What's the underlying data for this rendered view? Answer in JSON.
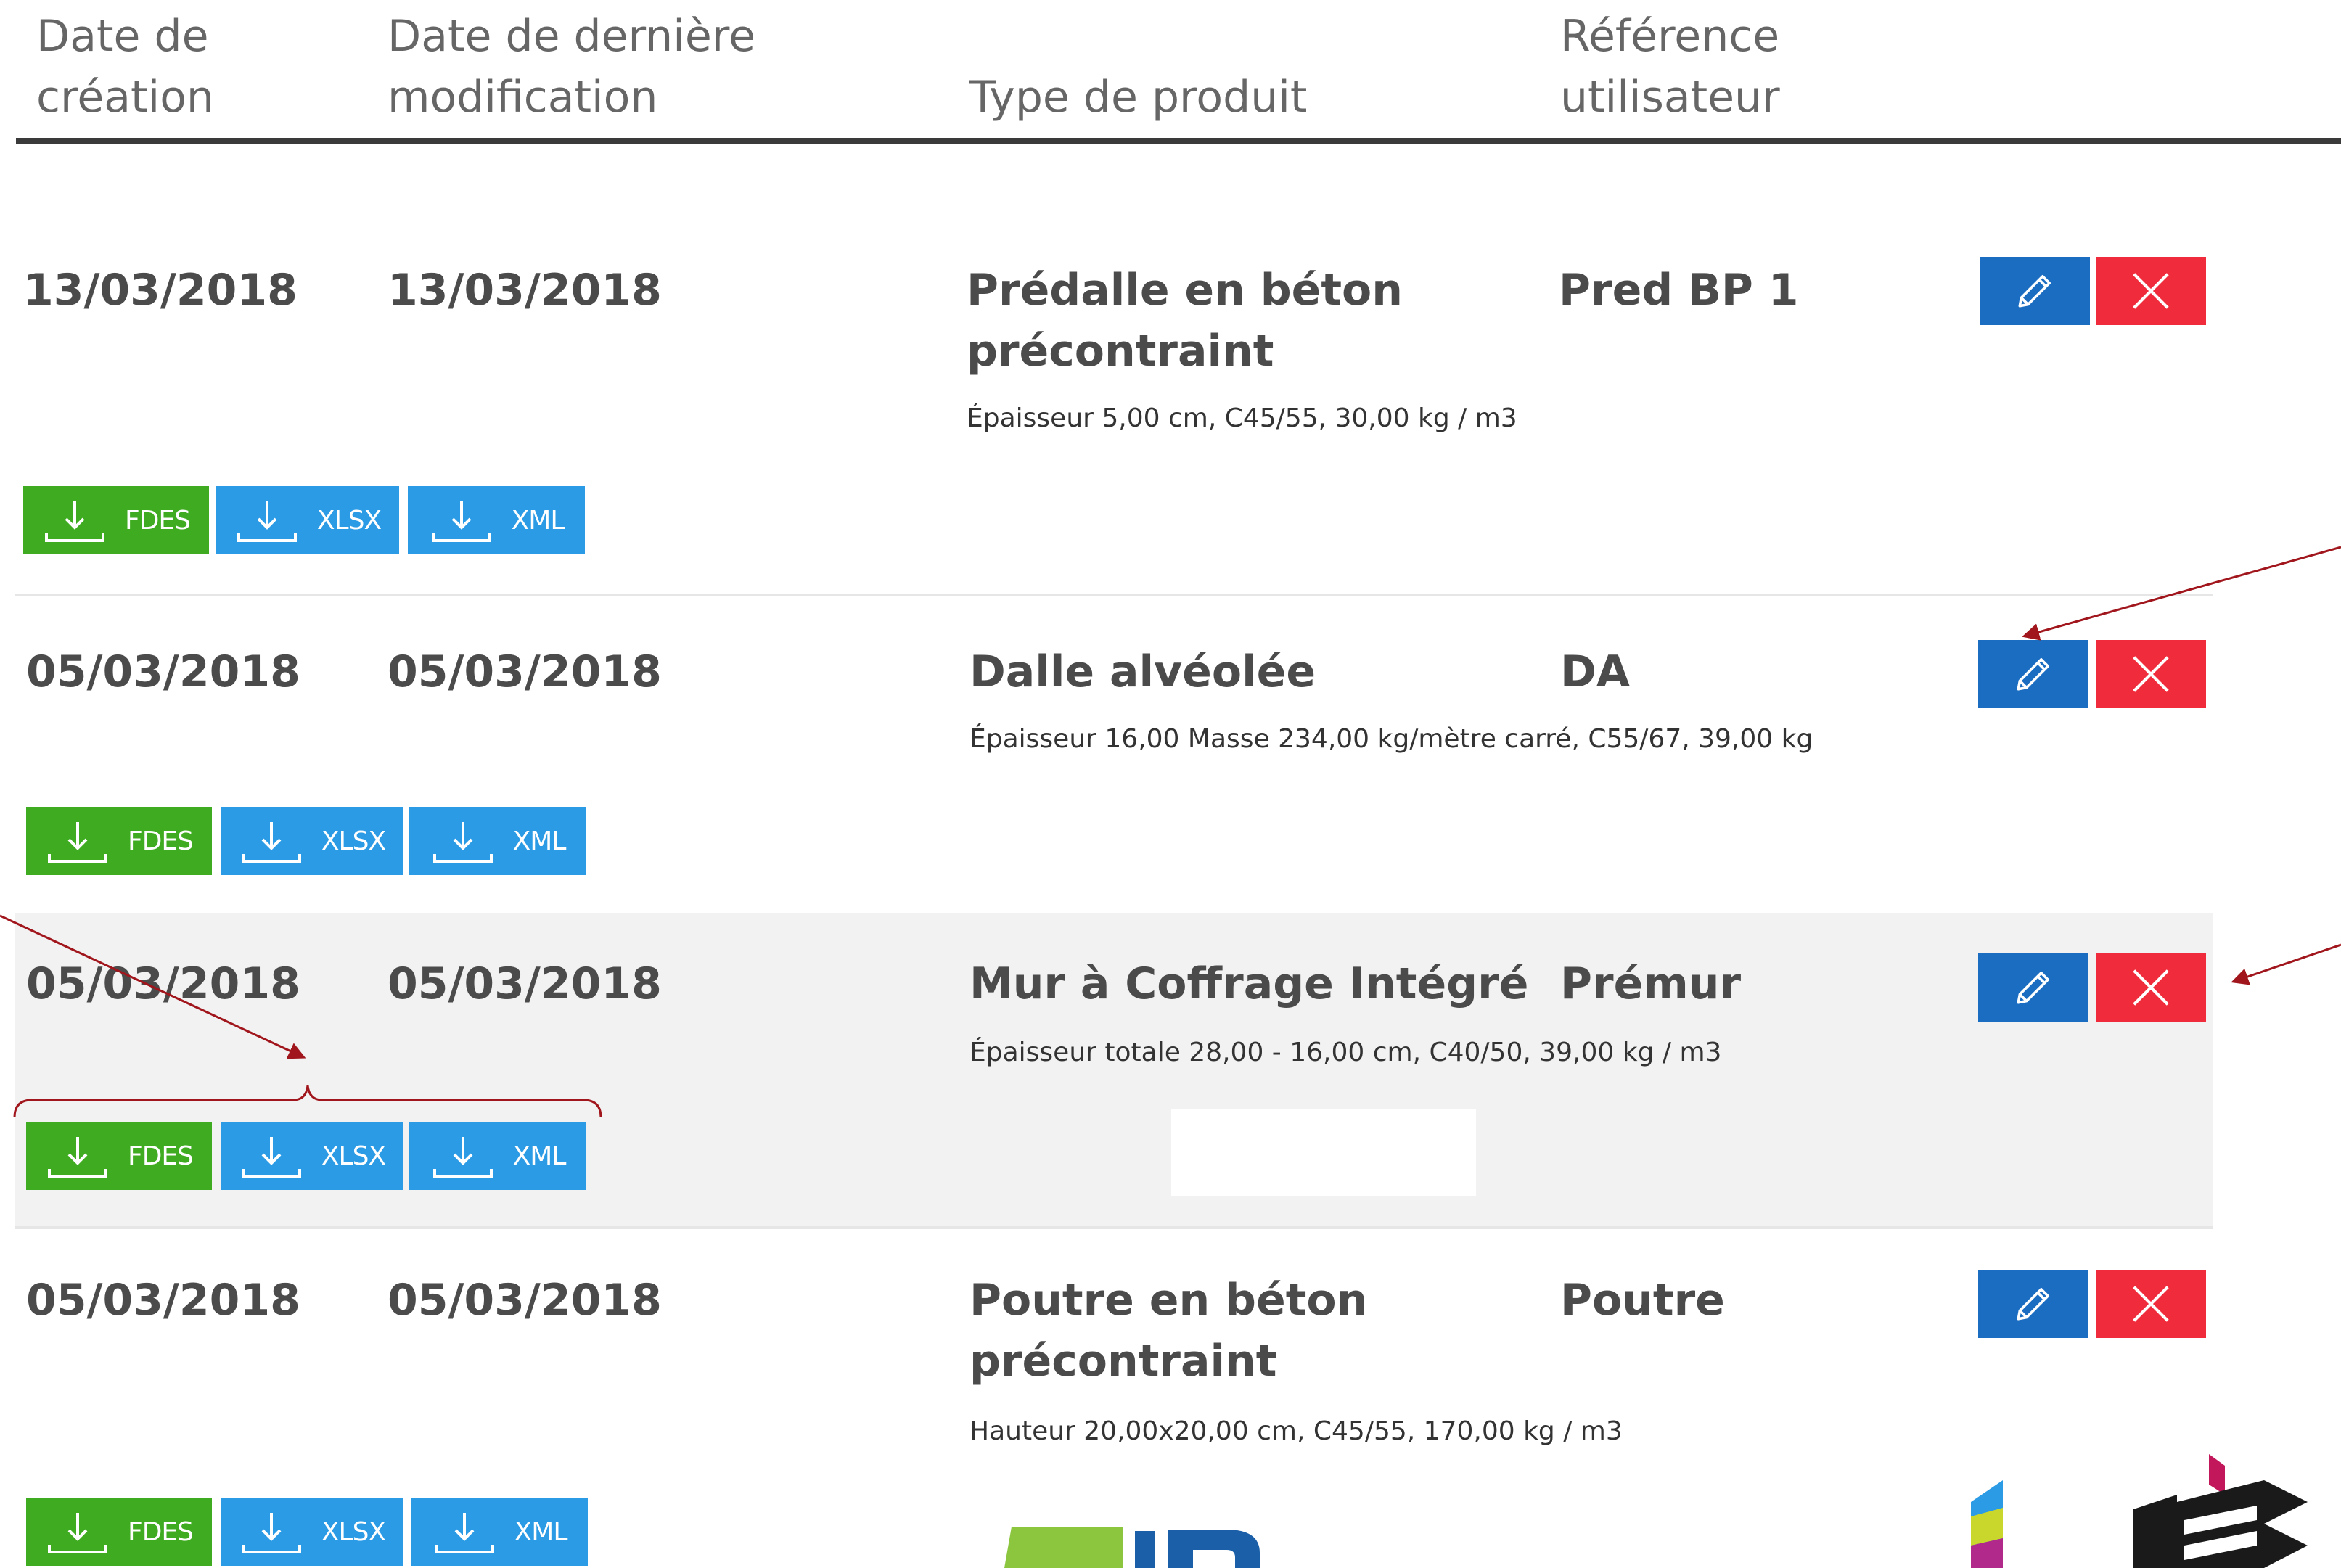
{
  "header": {
    "created_line1": "Date de",
    "created_line2": "création",
    "modified_line1": "Date de dernière",
    "modified_line2": "modification",
    "product_type": "Type de produit",
    "user_ref_line1": "Référence",
    "user_ref_line2": "utilisateur"
  },
  "rows": [
    {
      "created": "13/03/2018",
      "modified": "13/03/2018",
      "product_type": "Prédalle en béton précontraint",
      "description": "Épaisseur 5,00 cm, C45/55, 30,00 kg / m3",
      "user_ref": "Pred BP 1"
    },
    {
      "created": "05/03/2018",
      "modified": "05/03/2018",
      "product_type": "Dalle alvéolée",
      "description": "Épaisseur 16,00 Masse 234,00 kg/mètre carré, C55/67, 39,00 kg /...",
      "user_ref": "DA"
    },
    {
      "created": "05/03/2018",
      "modified": "05/03/2018",
      "product_type": "Mur à Coffrage Intégré",
      "description": "Épaisseur totale 28,00 - 16,00 cm, C40/50, 39,00 kg / m3",
      "user_ref": "Prémur"
    },
    {
      "created": "05/03/2018",
      "modified": "05/03/2018",
      "product_type": "Poutre en béton précontraint",
      "description": "Hauteur 20,00x20,00 cm, C45/55, 170,00 kg / m3",
      "user_ref": "Poutre"
    }
  ],
  "downloads": {
    "fdes_label": "FDES",
    "xlsx_label": "XLSX",
    "xml_label": "XML"
  },
  "icons": {
    "edit": "pencil-icon",
    "delete": "close-icon",
    "download": "download-icon"
  },
  "colors": {
    "edit_button": "#1b6dc1",
    "delete_button": "#ef2b3c",
    "fdes_button": "#3fab21",
    "xlsx_xml_button": "#2b9be5",
    "annotation_arrow": "#a0161c",
    "header_rule": "#3a3a3a"
  }
}
